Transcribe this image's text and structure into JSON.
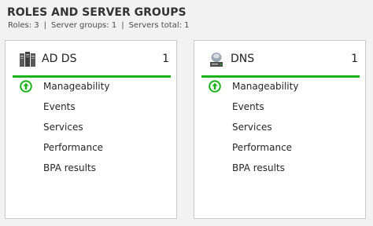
{
  "section": {
    "title": "ROLES AND SERVER GROUPS",
    "summary": {
      "roles": "Roles: 3",
      "server_groups": "Server groups: 1",
      "servers_total": "Servers total: 1",
      "separator": "|"
    }
  },
  "tiles": [
    {
      "name": "AD DS",
      "count": "1",
      "icon": "ad-ds-icon",
      "status_icon": "up-arrow-circle-icon",
      "metrics": [
        "Manageability",
        "Events",
        "Services",
        "Performance",
        "BPA results"
      ]
    },
    {
      "name": "DNS",
      "count": "1",
      "icon": "dns-icon",
      "status_icon": "up-arrow-circle-icon",
      "metrics": [
        "Manageability",
        "Events",
        "Services",
        "Performance",
        "BPA results"
      ]
    }
  ],
  "colors": {
    "status_green": "#1ab31a",
    "tile_border": "#c8c8c8",
    "background": "#f2f2f2"
  }
}
